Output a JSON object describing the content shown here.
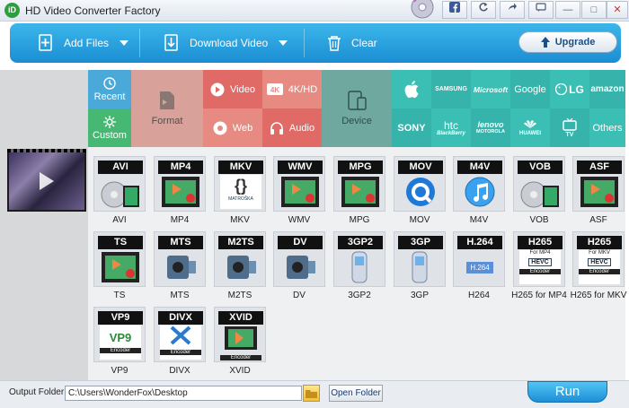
{
  "window": {
    "title": "HD Video Converter Factory",
    "logo_text": "iD",
    "controls": {
      "minimize": "—",
      "maximize": "□",
      "close": "✕"
    }
  },
  "toolbar": {
    "add_files": "Add Files",
    "download_video": "Download Video",
    "clear": "Clear",
    "upgrade": "Upgrade"
  },
  "categories": {
    "recent": "Recent",
    "custom": "Custom",
    "format": "Format",
    "video": "Video",
    "web": "Web",
    "hd": "4K/HD",
    "audio": "Audio",
    "device": "Device"
  },
  "brands": {
    "apple": "",
    "samsung": "SAMSUNG",
    "microsoft": "Microsoft",
    "google": "Google",
    "lg": "LG",
    "amazon": "amazon",
    "sony": "SONY",
    "htc": "htc",
    "htc_sub": "BlackBerry",
    "lenovo": "lenovo",
    "lenovo_sub": "MOTOROLA",
    "huawei": "HUAWEI",
    "tv": "TV",
    "others": "Others"
  },
  "formats": [
    {
      "tag": "AVI",
      "name": "AVI"
    },
    {
      "tag": "MP4",
      "name": "MP4"
    },
    {
      "tag": "MKV",
      "name": "MKV"
    },
    {
      "tag": "WMV",
      "name": "WMV"
    },
    {
      "tag": "MPG",
      "name": "MPG"
    },
    {
      "tag": "MOV",
      "name": "MOV"
    },
    {
      "tag": "M4V",
      "name": "M4V"
    },
    {
      "tag": "VOB",
      "name": "VOB"
    },
    {
      "tag": "ASF",
      "name": "ASF"
    },
    {
      "tag": "TS",
      "name": "TS"
    },
    {
      "tag": "MTS",
      "name": "MTS"
    },
    {
      "tag": "M2TS",
      "name": "M2TS"
    },
    {
      "tag": "DV",
      "name": "DV"
    },
    {
      "tag": "3GP2",
      "name": "3GP2"
    },
    {
      "tag": "3GP",
      "name": "3GP"
    },
    {
      "tag": "H.264",
      "name": "H264"
    },
    {
      "tag": "H265",
      "name": "H265 for MP4"
    },
    {
      "tag": "H265",
      "name": "H265 for MKV"
    },
    {
      "tag": "VP9",
      "name": "VP9"
    },
    {
      "tag": "DIVX",
      "name": "DIVX"
    },
    {
      "tag": "XVID",
      "name": "XVID"
    }
  ],
  "format_art": {
    "mkv_brand": "MATROŠKA",
    "h264_badge": "H.264",
    "h265_mp4_sub": "For MP4",
    "h265_mkv_sub": "For MKV",
    "hevc": "HEVC",
    "encoder": "Encoder",
    "vp9_badge": "VP9"
  },
  "bottom": {
    "output_label": "Output Folder:",
    "output_path": "C:\\Users\\WonderFox\\Desktop",
    "open_folder": "Open Folder",
    "run": "Run"
  }
}
